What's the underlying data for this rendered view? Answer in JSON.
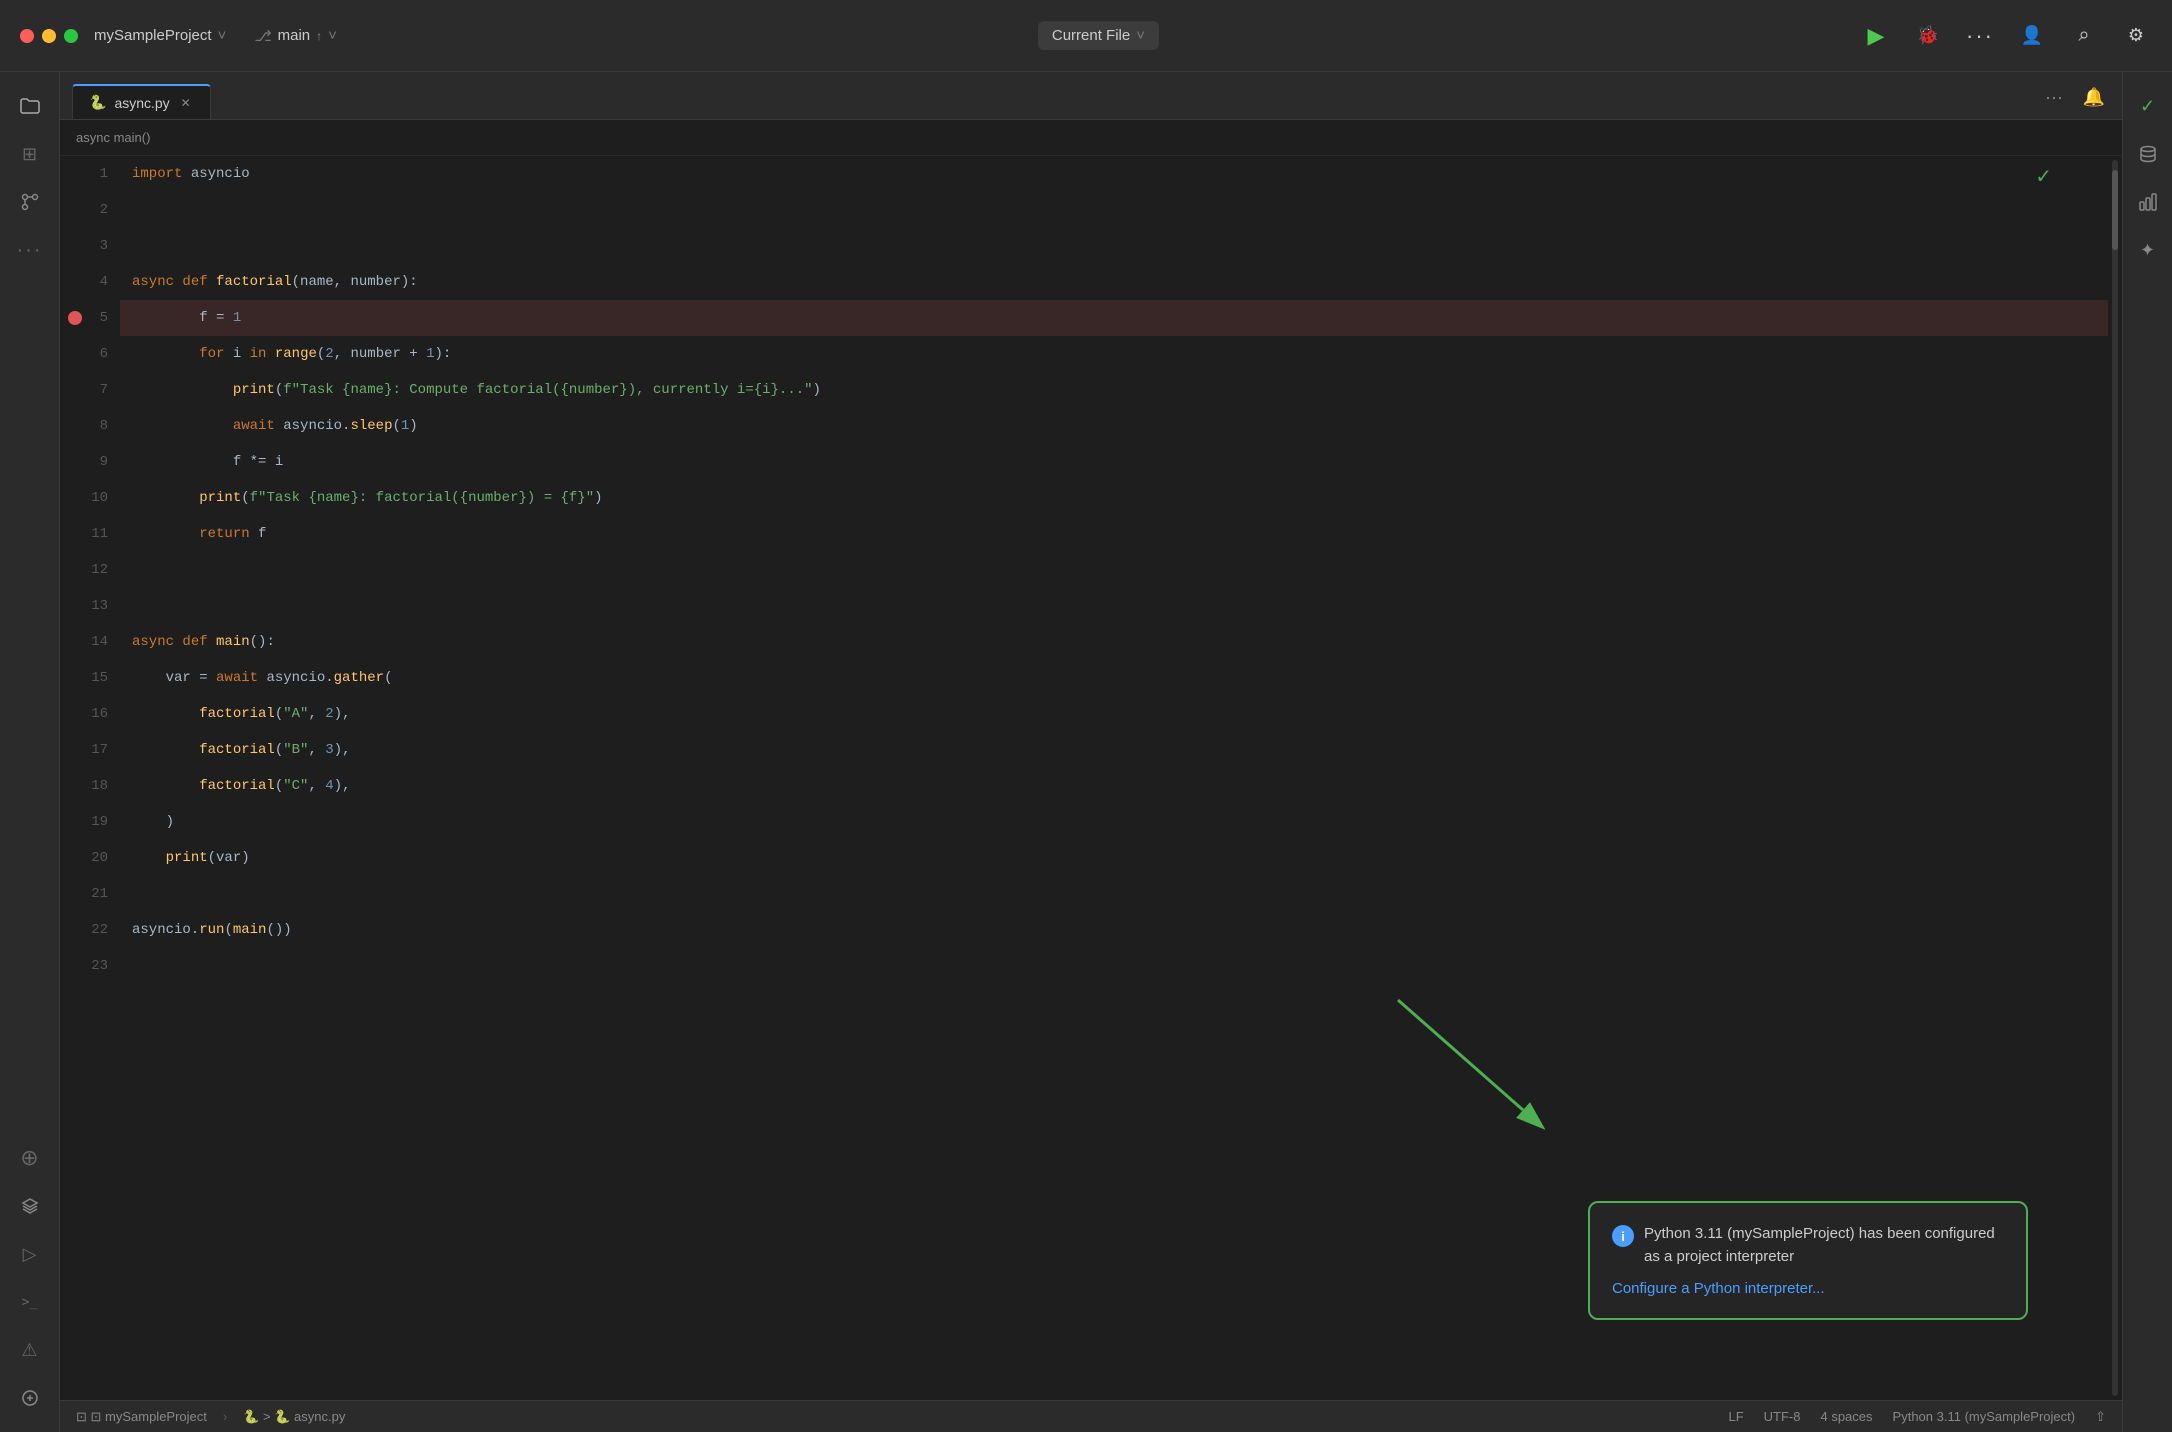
{
  "titlebar": {
    "project_name": "mySampleProject",
    "branch": "main",
    "current_file_label": "Current File",
    "run_icon": "▶",
    "debug_icon": "🐛",
    "more_icon": "⋯",
    "add_user_icon": "👤",
    "search_icon": "⌕",
    "settings_icon": "⚙"
  },
  "tabs": [
    {
      "icon": "🐍",
      "label": "async.py",
      "closable": true
    }
  ],
  "tab_actions": {
    "more_icon": "⋯",
    "bell_icon": "🔔"
  },
  "sidebar_left": {
    "icons": [
      {
        "name": "folder-icon",
        "symbol": "📁"
      },
      {
        "name": "search-icon",
        "symbol": "⊞"
      },
      {
        "name": "git-icon",
        "symbol": "⌥"
      },
      {
        "name": "more-icon",
        "symbol": "⋯"
      },
      {
        "name": "extension-icon",
        "symbol": "⊕"
      },
      {
        "name": "layers-icon",
        "symbol": "≡"
      },
      {
        "name": "run-icon",
        "symbol": "▷"
      },
      {
        "name": "terminal-icon",
        "symbol": ">_"
      },
      {
        "name": "error-icon",
        "symbol": "⚠"
      },
      {
        "name": "source-control-icon",
        "symbol": "⊗"
      }
    ]
  },
  "sidebar_right": {
    "icons": [
      {
        "name": "checkmark-icon",
        "symbol": "✓"
      },
      {
        "name": "database-icon",
        "symbol": "⊞"
      },
      {
        "name": "chart-icon",
        "symbol": "📊"
      },
      {
        "name": "sparkle-icon",
        "symbol": "✦"
      }
    ]
  },
  "code": {
    "lines": [
      {
        "num": 1,
        "content": "import asyncio",
        "tokens": [
          {
            "text": "import ",
            "class": "kw"
          },
          {
            "text": "asyncio",
            "class": "plain"
          }
        ]
      },
      {
        "num": 2,
        "content": "",
        "tokens": []
      },
      {
        "num": 3,
        "content": "",
        "tokens": []
      },
      {
        "num": 4,
        "content": "async def factorial(name, number):",
        "tokens": [
          {
            "text": "async ",
            "class": "kw"
          },
          {
            "text": "def ",
            "class": "kw"
          },
          {
            "text": "factorial",
            "class": "fn"
          },
          {
            "text": "(",
            "class": "plain"
          },
          {
            "text": "name",
            "class": "plain"
          },
          {
            "text": ", ",
            "class": "plain"
          },
          {
            "text": "number",
            "class": "plain"
          },
          {
            "text": "):",
            "class": "plain"
          }
        ]
      },
      {
        "num": 5,
        "content": "    f = 1",
        "breakpoint": true,
        "highlighted": true,
        "tokens": [
          {
            "text": "        ",
            "class": "plain"
          },
          {
            "text": "f",
            "class": "plain"
          },
          {
            "text": " = ",
            "class": "plain"
          },
          {
            "text": "1",
            "class": "num"
          }
        ]
      },
      {
        "num": 6,
        "content": "    for i in range(2, number + 1):",
        "tokens": [
          {
            "text": "        ",
            "class": "plain"
          },
          {
            "text": "for ",
            "class": "kw"
          },
          {
            "text": "i ",
            "class": "plain"
          },
          {
            "text": "in ",
            "class": "kw"
          },
          {
            "text": "range",
            "class": "fn"
          },
          {
            "text": "(",
            "class": "plain"
          },
          {
            "text": "2",
            "class": "num"
          },
          {
            "text": ", ",
            "class": "plain"
          },
          {
            "text": "number",
            "class": "plain"
          },
          {
            "text": " + ",
            "class": "plain"
          },
          {
            "text": "1",
            "class": "num"
          },
          {
            "text": "):",
            "class": "plain"
          }
        ]
      },
      {
        "num": 7,
        "content": "        print(f\"Task {name}: Compute factorial({number}), currently i={i}...\")",
        "tokens": [
          {
            "text": "            ",
            "class": "plain"
          },
          {
            "text": "print",
            "class": "fn"
          },
          {
            "text": "(",
            "class": "plain"
          },
          {
            "text": "f\"Task {name}: Compute factorial({number}), currently i={i}...\"",
            "class": "str"
          },
          {
            "text": ")",
            "class": "plain"
          }
        ]
      },
      {
        "num": 8,
        "content": "        await asyncio.sleep(1)",
        "tokens": [
          {
            "text": "            ",
            "class": "plain"
          },
          {
            "text": "await ",
            "class": "kw"
          },
          {
            "text": "asyncio",
            "class": "plain"
          },
          {
            "text": ".",
            "class": "plain"
          },
          {
            "text": "sleep",
            "class": "fn"
          },
          {
            "text": "(",
            "class": "plain"
          },
          {
            "text": "1",
            "class": "num"
          },
          {
            "text": ")",
            "class": "plain"
          }
        ]
      },
      {
        "num": 9,
        "content": "        f *= i",
        "tokens": [
          {
            "text": "            ",
            "class": "plain"
          },
          {
            "text": "f",
            "class": "plain"
          },
          {
            "text": " *= ",
            "class": "plain"
          },
          {
            "text": "i",
            "class": "plain"
          }
        ]
      },
      {
        "num": 10,
        "content": "    print(f\"Task {name}: factorial({number}) = {f}\")",
        "tokens": [
          {
            "text": "        ",
            "class": "plain"
          },
          {
            "text": "print",
            "class": "fn"
          },
          {
            "text": "(",
            "class": "plain"
          },
          {
            "text": "f\"Task {name}: factorial({number}) = {f}\"",
            "class": "str"
          },
          {
            "text": ")",
            "class": "plain"
          }
        ]
      },
      {
        "num": 11,
        "content": "    return f",
        "tokens": [
          {
            "text": "        ",
            "class": "plain"
          },
          {
            "text": "return ",
            "class": "kw"
          },
          {
            "text": "f",
            "class": "plain"
          }
        ]
      },
      {
        "num": 12,
        "content": "",
        "tokens": []
      },
      {
        "num": 13,
        "content": "",
        "tokens": []
      },
      {
        "num": 14,
        "content": "async def main():",
        "tokens": [
          {
            "text": "async ",
            "class": "kw"
          },
          {
            "text": "def ",
            "class": "kw"
          },
          {
            "text": "main",
            "class": "fn"
          },
          {
            "text": "():",
            "class": "plain"
          }
        ]
      },
      {
        "num": 15,
        "content": "    var = await asyncio.gather(",
        "tokens": [
          {
            "text": "    ",
            "class": "plain"
          },
          {
            "text": "var",
            "class": "plain"
          },
          {
            "text": " = ",
            "class": "plain"
          },
          {
            "text": "await ",
            "class": "kw"
          },
          {
            "text": "asyncio",
            "class": "plain"
          },
          {
            "text": ".",
            "class": "plain"
          },
          {
            "text": "gather",
            "class": "fn"
          },
          {
            "text": "(",
            "class": "plain"
          }
        ]
      },
      {
        "num": 16,
        "content": "        factorial(\"A\", 2),",
        "tokens": [
          {
            "text": "        ",
            "class": "plain"
          },
          {
            "text": "factorial",
            "class": "fn"
          },
          {
            "text": "(",
            "class": "plain"
          },
          {
            "text": "\"A\"",
            "class": "str"
          },
          {
            "text": ", ",
            "class": "plain"
          },
          {
            "text": "2",
            "class": "num"
          },
          {
            "text": "),",
            "class": "plain"
          }
        ]
      },
      {
        "num": 17,
        "content": "        factorial(\"B\", 3),",
        "tokens": [
          {
            "text": "        ",
            "class": "plain"
          },
          {
            "text": "factorial",
            "class": "fn"
          },
          {
            "text": "(",
            "class": "plain"
          },
          {
            "text": "\"B\"",
            "class": "str"
          },
          {
            "text": ", ",
            "class": "plain"
          },
          {
            "text": "3",
            "class": "num"
          },
          {
            "text": "),",
            "class": "plain"
          }
        ]
      },
      {
        "num": 18,
        "content": "        factorial(\"C\", 4),",
        "tokens": [
          {
            "text": "        ",
            "class": "plain"
          },
          {
            "text": "factorial",
            "class": "fn"
          },
          {
            "text": "(",
            "class": "plain"
          },
          {
            "text": "\"C\"",
            "class": "str"
          },
          {
            "text": ", ",
            "class": "plain"
          },
          {
            "text": "4",
            "class": "num"
          },
          {
            "text": "),",
            "class": "plain"
          }
        ]
      },
      {
        "num": 19,
        "content": "    )",
        "tokens": [
          {
            "text": "    )",
            "class": "plain"
          }
        ]
      },
      {
        "num": 20,
        "content": "    print(var)",
        "tokens": [
          {
            "text": "    ",
            "class": "plain"
          },
          {
            "text": "print",
            "class": "fn"
          },
          {
            "text": "(",
            "class": "plain"
          },
          {
            "text": "var",
            "class": "plain"
          },
          {
            "text": ")",
            "class": "plain"
          }
        ]
      },
      {
        "num": 21,
        "content": "",
        "tokens": []
      },
      {
        "num": 22,
        "content": "asyncio.run(main())",
        "tokens": [
          {
            "text": "asyncio",
            "class": "plain"
          },
          {
            "text": ".",
            "class": "plain"
          },
          {
            "text": "run",
            "class": "fn"
          },
          {
            "text": "(",
            "class": "plain"
          },
          {
            "text": "main",
            "class": "fn"
          },
          {
            "text": "())",
            "class": "plain"
          }
        ]
      },
      {
        "num": 23,
        "content": "",
        "tokens": []
      }
    ]
  },
  "breadcrumb": {
    "text": "async main()"
  },
  "status_bar": {
    "left": [
      {
        "name": "project-path",
        "text": "⊡ mySampleProject"
      },
      {
        "name": "file-path",
        "text": "> 🐍 async.py"
      }
    ],
    "right": [
      {
        "name": "line-ending",
        "text": "LF"
      },
      {
        "name": "encoding",
        "text": "UTF-8"
      },
      {
        "name": "indent",
        "text": "4 spaces"
      },
      {
        "name": "language",
        "text": "Python 3.11 (mySampleProject)"
      },
      {
        "name": "upload-icon",
        "text": "⇧"
      }
    ]
  },
  "tooltip": {
    "info_text": "Python 3.11 (mySampleProject) has been configured as a project interpreter",
    "link_text": "Configure a Python interpreter..."
  }
}
